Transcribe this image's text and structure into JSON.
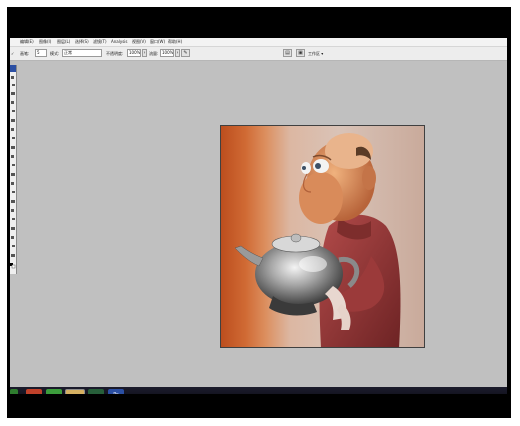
{
  "menu": {
    "items": [
      "编辑(E)",
      "图像(I)",
      "图层(L)",
      "选择(S)",
      "滤镜(T)",
      "Analysis",
      "视图(V)",
      "窗口(W)",
      "帮助(H)"
    ]
  },
  "options": {
    "brush_label": "画笔:",
    "mode_label": "模式:",
    "mode_value": "正常",
    "opacity_label": "不透明度:",
    "opacity_value": "100%",
    "flow_label": "流量:",
    "flow_value": "100%",
    "workspace_label": "工作区 ▾",
    "brush_size": "5"
  },
  "taskbar": {
    "apps": [
      "start",
      "media-player",
      "browser",
      "file-explorer",
      "media-center",
      "photoshop"
    ],
    "photoshop_label": "Ps"
  },
  "colors": {
    "workspace_bg": "#c0c0c0",
    "taskbar": "#11111b",
    "ps_blue": "#2b4fa3"
  }
}
